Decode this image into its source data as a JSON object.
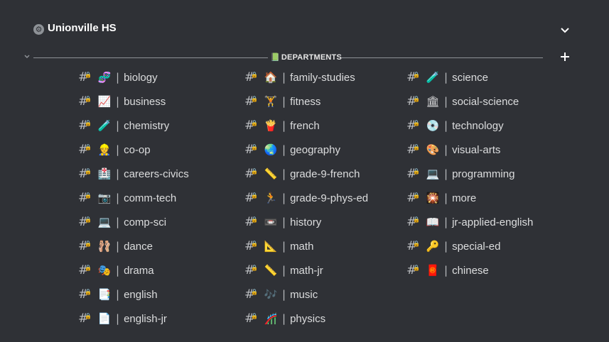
{
  "server": {
    "name": "Unionville HS",
    "icon": "gear-icon"
  },
  "category": {
    "label": "DEPARTMENTS",
    "icon": "book-icon"
  },
  "columns": [
    [
      {
        "emoji": "🧬",
        "name": "biology"
      },
      {
        "emoji": "📈",
        "name": "business"
      },
      {
        "emoji": "🧪",
        "name": "chemistry"
      },
      {
        "emoji": "👷",
        "name": "co-op"
      },
      {
        "emoji": "🏥",
        "name": "careers-civics"
      },
      {
        "emoji": "📷",
        "name": "comm-tech"
      },
      {
        "emoji": "💻",
        "name": "comp-sci"
      },
      {
        "emoji": "🩰",
        "name": "dance"
      },
      {
        "emoji": "🎭",
        "name": "drama"
      },
      {
        "emoji": "📑",
        "name": "english"
      },
      {
        "emoji": "📄",
        "name": "english-jr"
      }
    ],
    [
      {
        "emoji": "🏠",
        "name": "family-studies"
      },
      {
        "emoji": "🏋",
        "name": "fitness"
      },
      {
        "emoji": "🍟",
        "name": "french"
      },
      {
        "emoji": "🌏",
        "name": "geography"
      },
      {
        "emoji": "📏",
        "name": "grade-9-french"
      },
      {
        "emoji": "🏃",
        "name": "grade-9-phys-ed"
      },
      {
        "emoji": "📼",
        "name": "history"
      },
      {
        "emoji": "📐",
        "name": "math"
      },
      {
        "emoji": "📏",
        "name": "math-jr"
      },
      {
        "emoji": "🎶",
        "name": "music"
      },
      {
        "emoji": "🎢",
        "name": "physics"
      }
    ],
    [
      {
        "emoji": "🧪",
        "name": "science"
      },
      {
        "emoji": "🏛",
        "name": "social-science"
      },
      {
        "emoji": "💿",
        "name": "technology"
      },
      {
        "emoji": "🎨",
        "name": "visual-arts"
      },
      {
        "emoji": "💻",
        "name": "programming"
      },
      {
        "emoji": "🎇",
        "name": "more"
      },
      {
        "emoji": "📖",
        "name": "jr-applied-english"
      },
      {
        "emoji": "🔑",
        "name": "special-ed"
      },
      {
        "emoji": "🧧",
        "name": "chinese"
      }
    ]
  ],
  "glyphs": {
    "hash": "#",
    "lock": "🔒",
    "separator": "|",
    "chevron": "⌄",
    "plus": "+"
  }
}
